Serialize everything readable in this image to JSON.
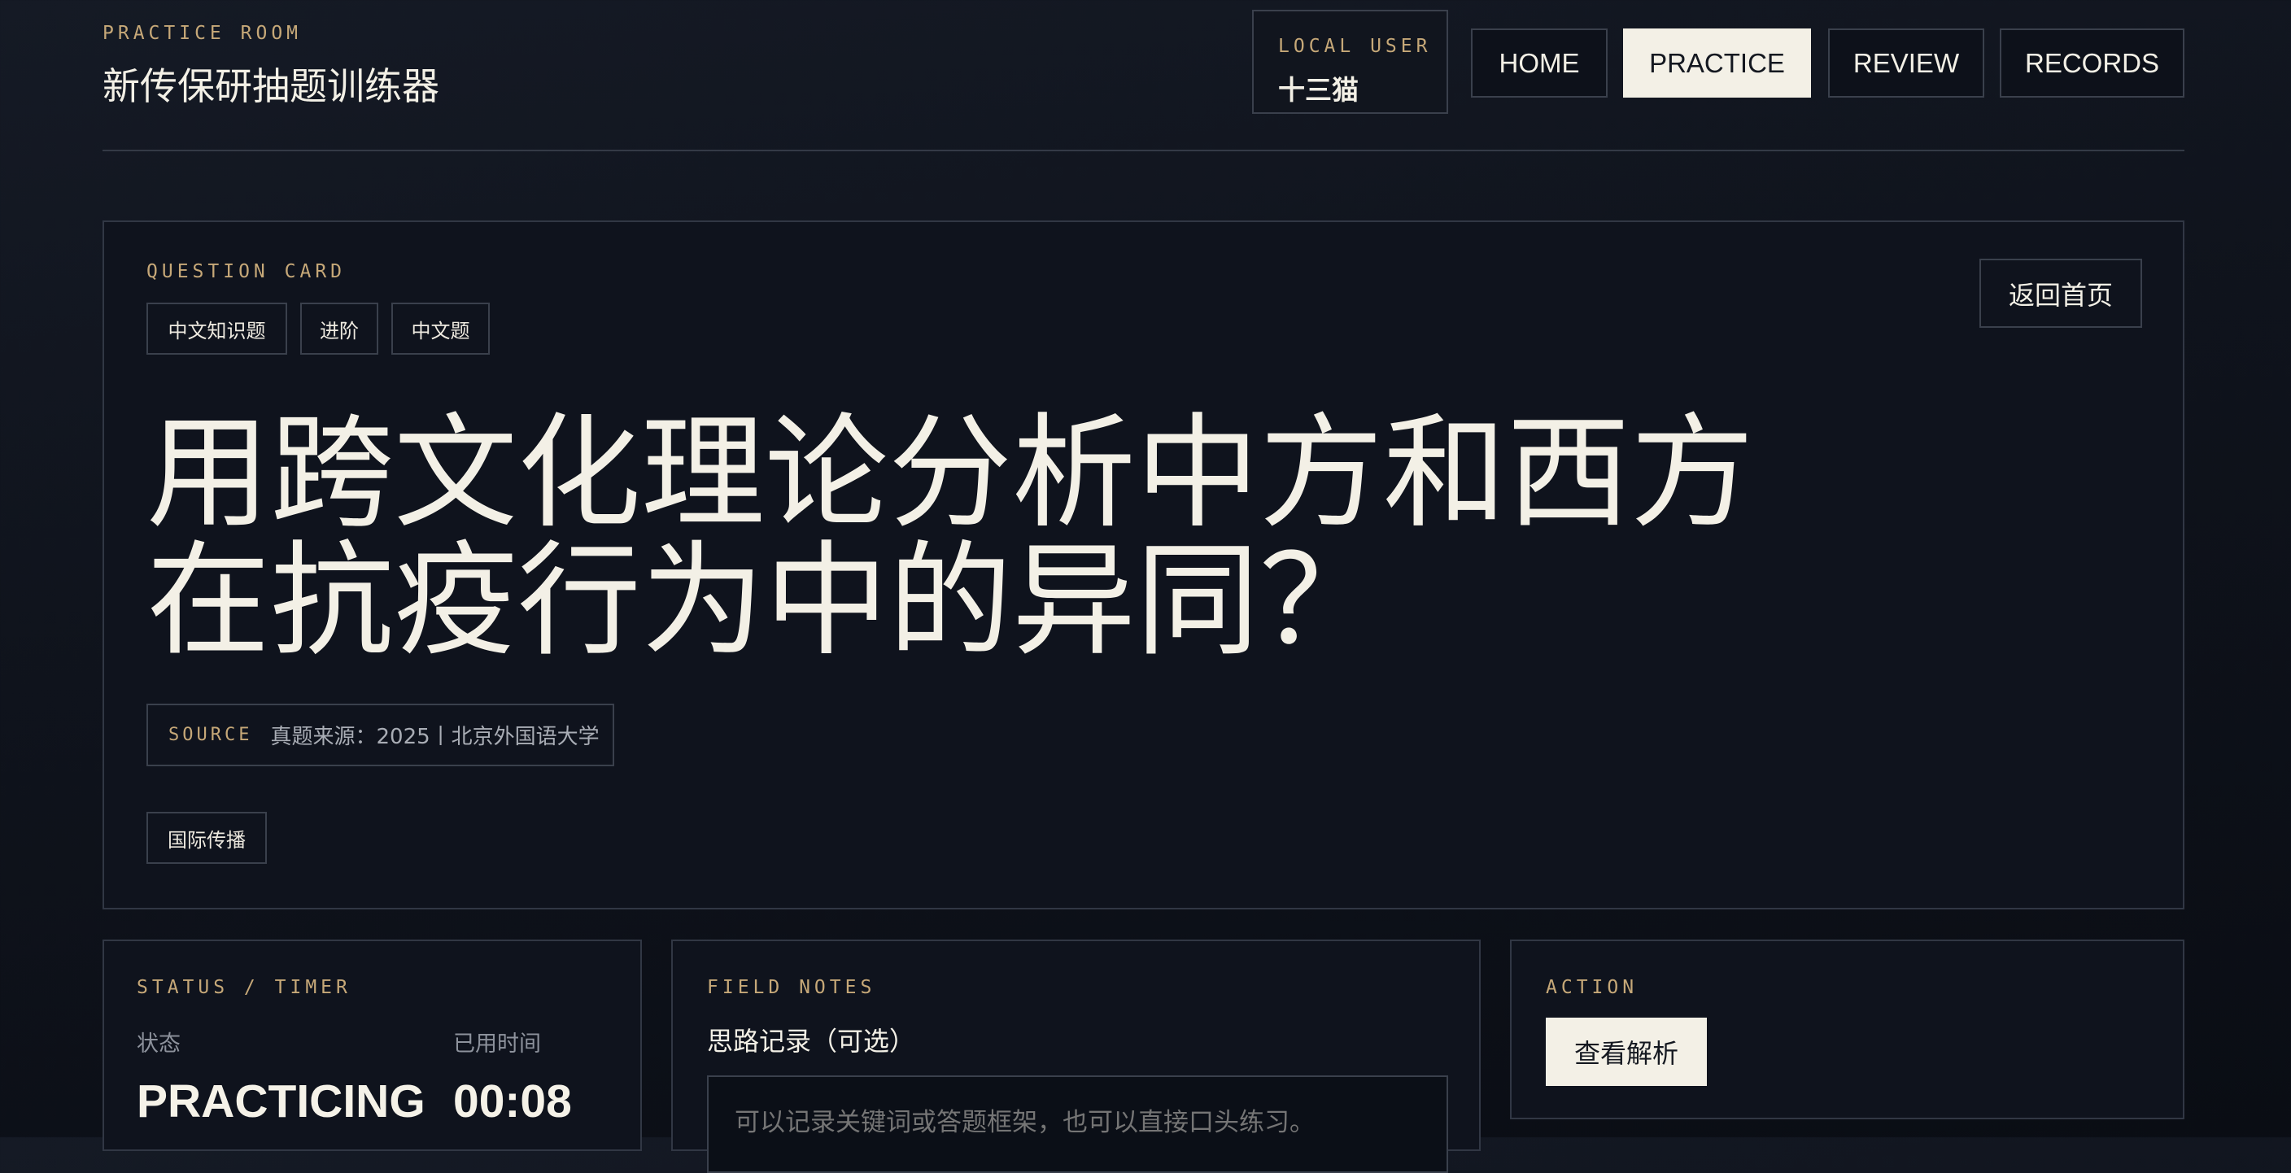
{
  "header": {
    "eyebrow": "PRACTICE ROOM",
    "title": "新传保研抽题训练器",
    "user_label": "LOCAL USER",
    "user_name": "十三猫",
    "nav": [
      {
        "label": "HOME",
        "active": false
      },
      {
        "label": "PRACTICE",
        "active": true
      },
      {
        "label": "REVIEW",
        "active": false
      },
      {
        "label": "RECORDS",
        "active": false
      }
    ]
  },
  "question_card": {
    "eyebrow": "QUESTION CARD",
    "tags": [
      "中文知识题",
      "进阶",
      "中文题"
    ],
    "back_button": "返回首页",
    "question_line1": "用跨文化理论分析中方和西方",
    "question_line2": "在抗疫行为中的异同？",
    "source_label": "SOURCE",
    "source_text": "真题来源：2025丨北京外国语大学",
    "topic_tag": "国际传播"
  },
  "status_panel": {
    "eyebrow": "STATUS / TIMER",
    "status_label": "状态",
    "status_value": "PRACTICING",
    "time_label": "已用时间",
    "time_value": "00:08"
  },
  "notes_panel": {
    "eyebrow": "FIELD NOTES",
    "title": "思路记录（可选）",
    "placeholder": "可以记录关键词或答题框架，也可以直接口头练习。"
  },
  "action_panel": {
    "eyebrow": "ACTION",
    "button": "查看解析"
  },
  "colors": {
    "background": "#0f131c",
    "accent_gold": "#c6a878",
    "text_light": "#f3f0e6",
    "button_light": "#f3f0e6"
  }
}
